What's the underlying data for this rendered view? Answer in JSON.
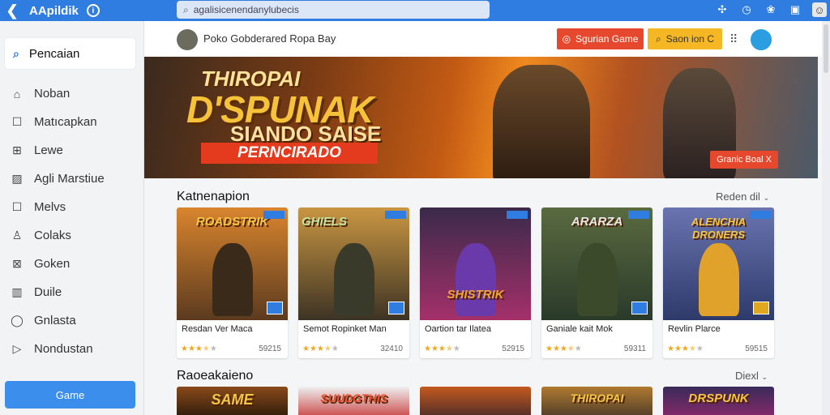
{
  "topbar": {
    "back_icon": "chevron-left-icon",
    "title": "AApildik",
    "info_icon": "info-icon",
    "search_value": "agalisicenendanylubecis",
    "right_icons": [
      "puzzle-icon",
      "clock-icon",
      "paw-icon",
      "video-icon",
      "user-icon"
    ]
  },
  "sidebar": {
    "search_label": "Pencaian",
    "items": [
      {
        "icon": "home-icon",
        "label": "Noban"
      },
      {
        "icon": "square-icon",
        "label": "Matıcapkan"
      },
      {
        "icon": "grid-icon",
        "label": "Lewe"
      },
      {
        "icon": "image-icon",
        "label": "Agli Marstiue"
      },
      {
        "icon": "square-icon",
        "label": "Melvs"
      },
      {
        "icon": "user-icon",
        "label": "Colaks"
      },
      {
        "icon": "grid-icon",
        "label": "Goken"
      },
      {
        "icon": "chart-icon",
        "label": "Duile"
      },
      {
        "icon": "circle-icon",
        "label": "Gnlasta"
      },
      {
        "icon": "play-icon",
        "label": "Nondustan"
      }
    ],
    "bottom_button": "Game"
  },
  "header": {
    "page_title": "Poko Gobderared Ropa Bay",
    "red_button": "Sgurian Game",
    "yellow_button": "Saon ion C"
  },
  "banner": {
    "title_line1": "THIROPAI",
    "title_line2": "D'SPUNAK",
    "title_line3": "SIANDO SAISE",
    "ribbon": "PERNCIRADO",
    "cta": "Granic Boal X"
  },
  "section1": {
    "title": "Katnenapion",
    "link": "Reden dil",
    "cards": [
      {
        "art": "ROADSTRIK",
        "name": "Resdan Ver Maca",
        "stars": 3.5,
        "count": "59215",
        "colors": [
          "#d9852e",
          "#5b3a1f"
        ]
      },
      {
        "art": "GHIELS",
        "name": "Semot Ropinket Man",
        "stars": 3.5,
        "count": "32410",
        "colors": [
          "#c99642",
          "#3d3324"
        ]
      },
      {
        "art": "SHISTRIK",
        "name": "Oartion tar Ilatea",
        "stars": 3.5,
        "count": "52915",
        "colors": [
          "#3a2a4a",
          "#a4306a"
        ]
      },
      {
        "art": "ARARZA",
        "name": "Ganiale kait Mok",
        "stars": 3.5,
        "count": "59311",
        "colors": [
          "#5a6a40",
          "#2a3a2a"
        ]
      },
      {
        "art": "ALENCHIA DRONERS",
        "name": "Revlin Plarce",
        "stars": 3.5,
        "count": "59515",
        "colors": [
          "#6a74b0",
          "#2d3a6a"
        ]
      }
    ]
  },
  "section2": {
    "title": "Raoeakaieno",
    "link": "Diexl",
    "cards": [
      {
        "art": "SAME",
        "colors": [
          "#8a4a1a",
          "#2a1a0a"
        ]
      },
      {
        "art": "SUUDGTHIS",
        "colors": [
          "#f0f0f0",
          "#c84040"
        ]
      },
      {
        "art": "",
        "colors": [
          "#c45a1e",
          "#4a2a2a"
        ]
      },
      {
        "art": "THIROPAI",
        "colors": [
          "#b07a30",
          "#4a3a2a"
        ]
      },
      {
        "art": "DRSPUNK",
        "colors": [
          "#3a2a5a",
          "#8a2a6a"
        ]
      }
    ]
  },
  "accent": "#2f7de1"
}
